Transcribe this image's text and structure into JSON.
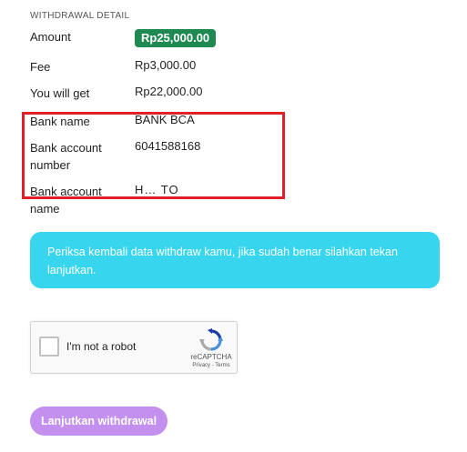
{
  "section_title": "WITHDRAWAL DETAIL",
  "details": {
    "amount_label": "Amount",
    "amount_value": "Rp25,000.00",
    "fee_label": "Fee",
    "fee_value": "Rp3,000.00",
    "you_get_label": "You will get",
    "you_get_value": "Rp22,000.00",
    "bank_name_label": "Bank name",
    "bank_name_value": "BANK BCA",
    "account_number_label_1": "Bank account",
    "account_number_label_2": "number",
    "account_number_value": "6041588168",
    "account_name_label_1": "Bank account",
    "account_name_label_2": "name",
    "account_name_value": "H… TO"
  },
  "notice_text": "Periksa kembali data withdraw kamu, jika sudah benar silahkan tekan lanjutkan.",
  "captcha": {
    "label": "I'm not a robot",
    "brand": "reCAPTCHA",
    "links": "Privacy - Terms",
    "icon": "recaptcha-logo-icon"
  },
  "submit_label": "Lanjutkan withdrawal",
  "colors": {
    "amount_badge": "#1e8a52",
    "highlight_border": "#e0202b",
    "notice_bg": "#38d6ee",
    "submit_bg": "#c390ef"
  }
}
